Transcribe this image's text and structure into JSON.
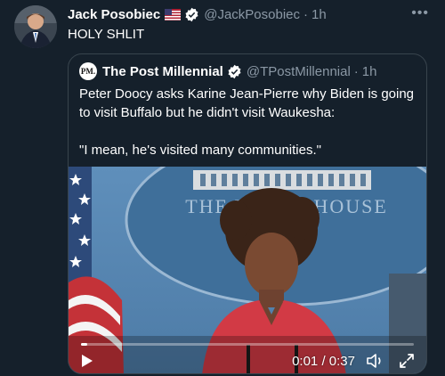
{
  "tweet": {
    "author_name": "Jack Posobiec",
    "author_handle": "@JackPosobiec",
    "separator": "·",
    "time": "1h",
    "text": "HOLY SHLIT",
    "more_icon": "more-horizontal-icon"
  },
  "quoted": {
    "avatar_text": "PM.",
    "author_name": "The Post Millennial",
    "author_handle": "@TPostMillennial",
    "separator": "·",
    "time": "1h",
    "text_line1": "Peter Doocy asks Karine Jean-Pierre why Biden is going to visit Buffalo but he didn't visit Waukesha:",
    "text_line2": "\"I mean, he's visited many communities.\""
  },
  "video": {
    "backdrop_text": "THE WHITE HOUSE",
    "current_time": "0:01",
    "duration": "0:37",
    "time_separator": " / ",
    "progress": 0.02
  },
  "colors": {
    "background": "#15202b",
    "border": "#38444d",
    "secondary_text": "#8b98a5",
    "verified": "#1d9bf0"
  }
}
